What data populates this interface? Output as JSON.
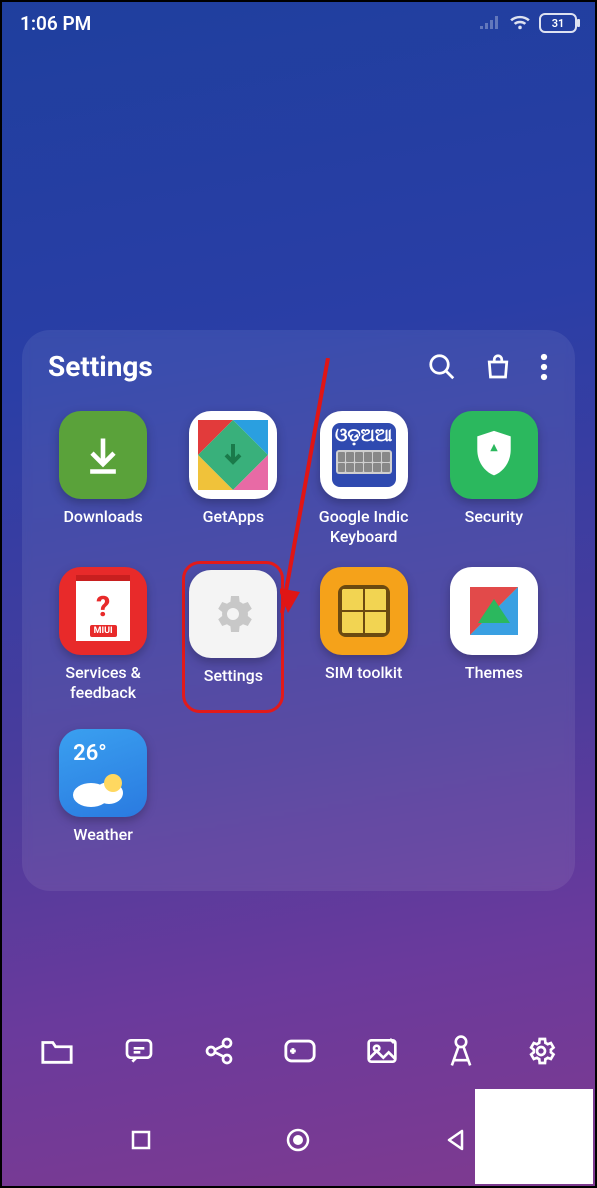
{
  "status": {
    "time": "1:06 PM",
    "battery": "31"
  },
  "folder": {
    "title": "Settings",
    "apps": [
      {
        "label": "Downloads"
      },
      {
        "label": "GetApps"
      },
      {
        "label": "Google Indic Keyboard"
      },
      {
        "label": "Security"
      },
      {
        "label": "Services & feedback"
      },
      {
        "label": "Settings"
      },
      {
        "label": "SIM toolkit"
      },
      {
        "label": "Themes"
      },
      {
        "label": "Weather",
        "temp": "26°"
      }
    ],
    "indic_text": "ଓଡ଼ଅଆ",
    "sf_miui": "MIUI",
    "sf_q": "?"
  }
}
